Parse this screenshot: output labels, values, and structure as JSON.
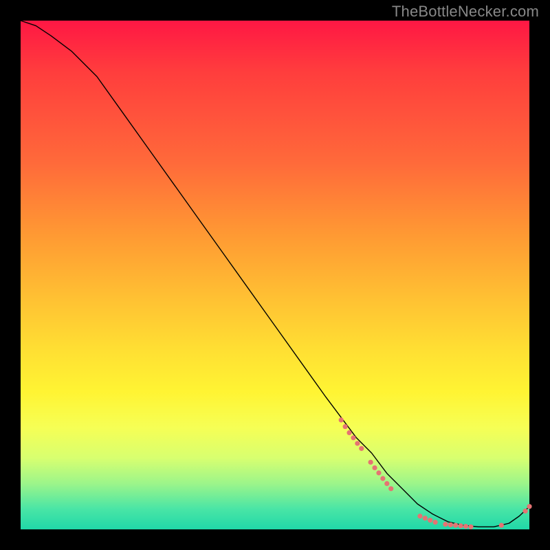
{
  "attribution": "TheBottleNecker.com",
  "chart_data": {
    "type": "line",
    "title": "",
    "xlabel": "",
    "ylabel": "",
    "xlim": [
      0,
      100
    ],
    "ylim": [
      0,
      100
    ],
    "grid": false,
    "legend": false,
    "series": [
      {
        "name": "curve",
        "x": [
          0,
          3,
          6,
          10,
          15,
          20,
          25,
          30,
          35,
          40,
          45,
          50,
          55,
          60,
          63,
          66,
          69,
          72,
          75,
          78,
          81,
          84,
          87,
          90,
          93,
          96,
          98,
          100
        ],
        "y": [
          100,
          99,
          97,
          94,
          89,
          82,
          75,
          68,
          61,
          54,
          47,
          40,
          33,
          26,
          22,
          18,
          15,
          11,
          8,
          5,
          3,
          1.5,
          0.8,
          0.5,
          0.5,
          1.2,
          2.6,
          4.5
        ]
      }
    ],
    "markers": [
      {
        "x": 63.0,
        "y": 21.5,
        "r": 3.6
      },
      {
        "x": 63.8,
        "y": 20.2,
        "r": 3.6
      },
      {
        "x": 64.6,
        "y": 19.0,
        "r": 3.6
      },
      {
        "x": 65.4,
        "y": 18.0,
        "r": 3.6
      },
      {
        "x": 66.2,
        "y": 16.9,
        "r": 3.6
      },
      {
        "x": 67.0,
        "y": 15.9,
        "r": 3.6
      },
      {
        "x": 68.8,
        "y": 13.2,
        "r": 3.6
      },
      {
        "x": 69.6,
        "y": 12.1,
        "r": 3.6
      },
      {
        "x": 70.4,
        "y": 11.1,
        "r": 3.6
      },
      {
        "x": 71.2,
        "y": 10.0,
        "r": 3.6
      },
      {
        "x": 72.0,
        "y": 9.0,
        "r": 3.6
      },
      {
        "x": 72.8,
        "y": 8.0,
        "r": 3.6
      },
      {
        "x": 78.5,
        "y": 2.6,
        "r": 3.6
      },
      {
        "x": 79.5,
        "y": 2.2,
        "r": 3.6
      },
      {
        "x": 80.5,
        "y": 1.8,
        "r": 3.6
      },
      {
        "x": 81.5,
        "y": 1.4,
        "r": 3.6
      },
      {
        "x": 83.5,
        "y": 1.0,
        "r": 3.6
      },
      {
        "x": 84.5,
        "y": 0.9,
        "r": 3.6
      },
      {
        "x": 85.5,
        "y": 0.8,
        "r": 3.6
      },
      {
        "x": 86.5,
        "y": 0.7,
        "r": 3.6
      },
      {
        "x": 87.5,
        "y": 0.6,
        "r": 3.6
      },
      {
        "x": 88.5,
        "y": 0.5,
        "r": 3.6
      },
      {
        "x": 94.5,
        "y": 0.8,
        "r": 3.6
      },
      {
        "x": 99.2,
        "y": 3.6,
        "r": 3.6
      },
      {
        "x": 100.0,
        "y": 4.5,
        "r": 3.6
      }
    ]
  }
}
